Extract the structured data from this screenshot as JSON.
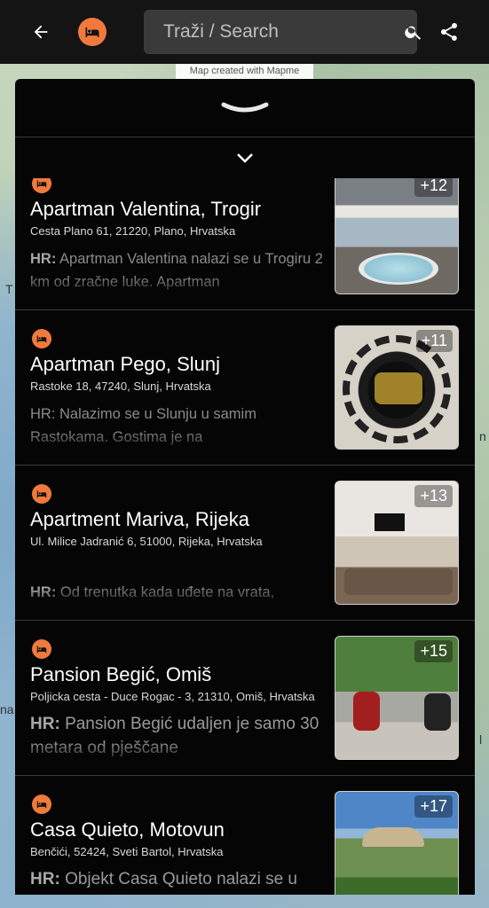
{
  "topbar": {
    "search_placeholder": "Traži / Search",
    "back_icon": "arrow-left-icon",
    "category_icon": "bed-icon",
    "search_icon": "magnifier-icon",
    "share_icon": "share-icon",
    "accent_color": "#f07a3c"
  },
  "map": {
    "credit": "Map created with Mapme",
    "side_labels": [
      "T",
      "n",
      "na",
      "l"
    ]
  },
  "panel": {
    "handle_icon": "chevron-down-wide-icon",
    "collapse_icon": "chevron-down-icon"
  },
  "listings": [
    {
      "title": "Apartman Valentina, Trogir",
      "address": "Cesta Plano 61, 21220, Plano, Hrvatska",
      "desc_prefix": "HR:",
      "desc": "Apartman Valentina nalazi se u Trogiru 2 km od zračne luke. Apartman",
      "photo_count": "+12"
    },
    {
      "title": "Apartman Pego, Slunj",
      "address": "Rastoke 18, 47240, Slunj, Hrvatska",
      "desc_prefix": "HR:",
      "desc": "Nalazimo se u Slunju u samim Rastokama. Gostima je na",
      "photo_count": "+11"
    },
    {
      "title": "Apartment Mariva, Rijeka",
      "address": "Ul. Milice Jadranić 6, 51000, Rijeka, Hrvatska",
      "desc_prefix": "HR:",
      "desc": "Od trenutka kada uđete na vrata,",
      "photo_count": "+13"
    },
    {
      "title": "Pansion Begić, Omiš",
      "address": "Poljicka cesta - Duce Rogac - 3, 21310, Omiš, Hrvatska",
      "desc_prefix": "HR:",
      "desc": "Pansion Begić udaljen je samo 30 metara od pješčane",
      "photo_count": "+15"
    },
    {
      "title": "Casa Quieto, Motovun",
      "address": "Benčići, 52424, Sveti Bartol, Hrvatska",
      "desc_prefix": "HR:",
      "desc": "Objekt Casa Quieto nalazi se u",
      "photo_count": "+17"
    }
  ]
}
